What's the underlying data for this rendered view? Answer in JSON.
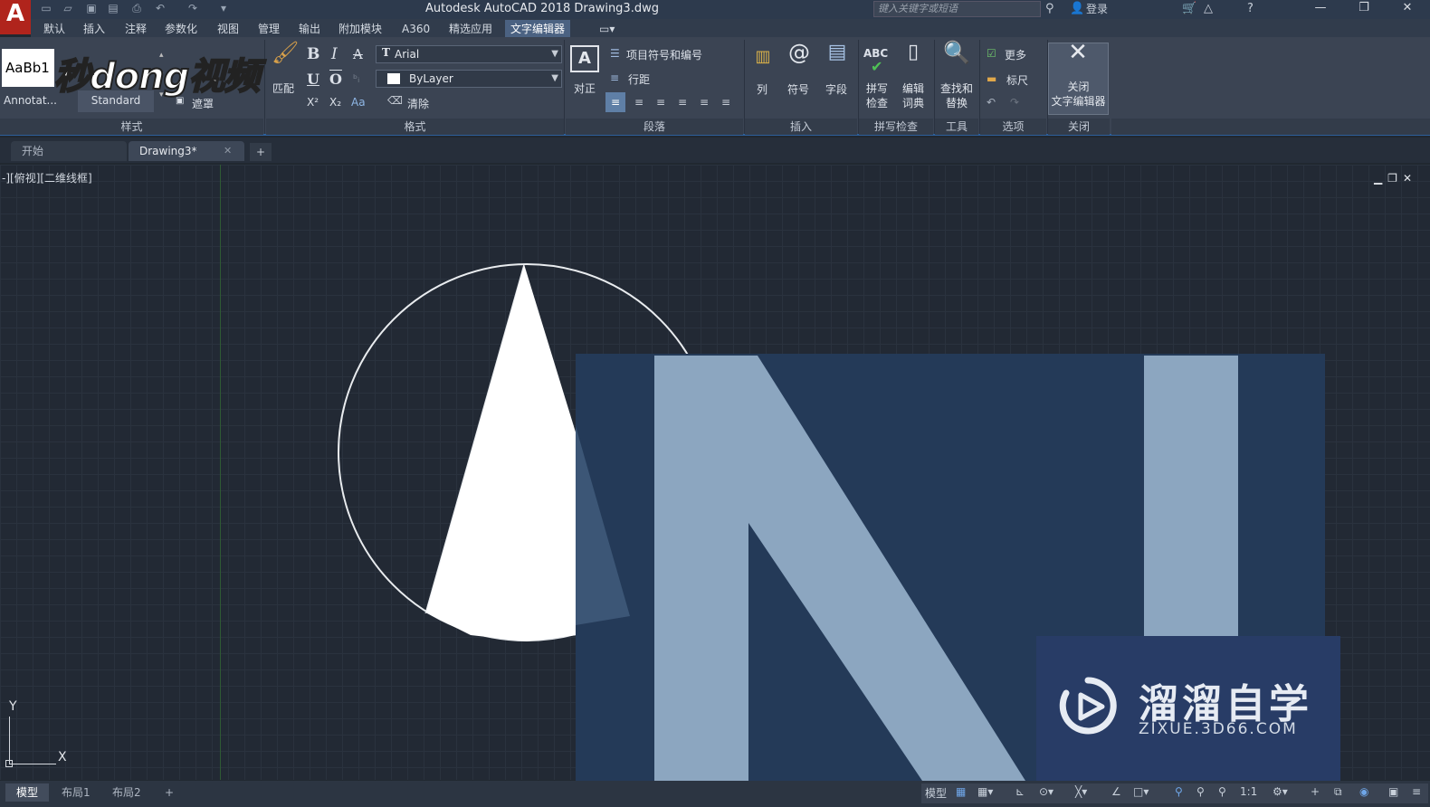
{
  "titlebar": {
    "title": "Autodesk AutoCAD 2018    Drawing3.dwg",
    "search_placeholder": "键入关键字或短语",
    "login": "登录",
    "minimize": "—",
    "maximize": "❐",
    "close": "✕"
  },
  "menu": {
    "tabs": [
      "默认",
      "插入",
      "注释",
      "参数化",
      "视图",
      "管理",
      "输出",
      "附加模块",
      "A360",
      "精选应用",
      "文字编辑器"
    ]
  },
  "ribbon": {
    "style_panel": {
      "sample": "AaBb1",
      "annotative": "Annotat...",
      "standard": "Standard",
      "mask": "遮罩",
      "title": "样式"
    },
    "format_panel": {
      "match": "匹配",
      "bold": "B",
      "italic": "I",
      "strike": "A",
      "underline": "U",
      "overline": "O",
      "superscript": "X²",
      "subscript": "X₂",
      "case": "Aa",
      "font": "Arial",
      "color": "ByLayer",
      "clear": "清除",
      "title": "格式"
    },
    "paragraph_panel": {
      "justify": "对正",
      "bullets": "项目符号和编号",
      "line_spacing": "行距",
      "title": "段落"
    },
    "insert_panel": {
      "columns": "列",
      "symbol": "符号",
      "field": "字段",
      "title": "插入"
    },
    "spell_panel": {
      "spell_check": "拼写\n检查",
      "edit_dict": "编辑\n词典",
      "abc": "ABC",
      "title": "拼写检查"
    },
    "tools_panel": {
      "find_replace": "查找和\n替换",
      "title": "工具"
    },
    "options_panel": {
      "more": "更多",
      "ruler": "标尺",
      "title": "选项"
    },
    "close_panel": {
      "close_editor": "关闭\n文字编辑器",
      "title": "关闭"
    }
  },
  "doc_tabs": {
    "start": "开始",
    "drawing": "Drawing3*",
    "add": "+"
  },
  "viewport": {
    "label": "-][俯视][二维线框]",
    "axis_y": "Y",
    "axis_x": "X"
  },
  "watermark": {
    "text": "秒dong视频",
    "zixue_title": "溜溜自学",
    "zixue_url": "ZIXUE.3D66.COM"
  },
  "statusbar": {
    "tabs": [
      "模型",
      "布局1",
      "布局2",
      "+"
    ],
    "model": "模型",
    "scale": "1:1"
  },
  "colors": {
    "accent": "#2d5f9b",
    "overlay_dark": "#243a58",
    "overlay_light": "#8ca6c0",
    "logo_red": "#b0241c"
  }
}
